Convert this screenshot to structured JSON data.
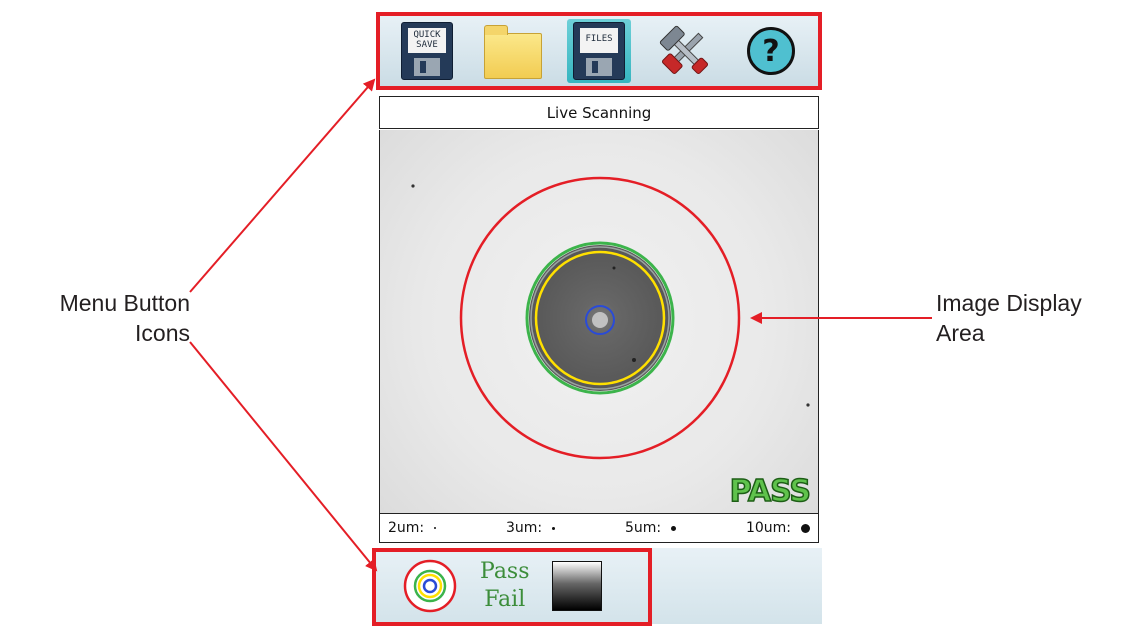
{
  "toolbar": {
    "buttons": [
      {
        "name": "quick-save",
        "icon": "floppy-disk-icon",
        "label": "QUICK SAVE"
      },
      {
        "name": "folder",
        "icon": "folder-icon"
      },
      {
        "name": "files",
        "icon": "floppy-disk-icon",
        "label": "FILES",
        "active": true
      },
      {
        "name": "settings",
        "icon": "wrench-hammer-icon"
      },
      {
        "name": "help",
        "icon": "help-icon",
        "glyph": "?"
      }
    ]
  },
  "status_text": "Live Scanning",
  "image": {
    "verdict": "PASS",
    "verdict_color": "#5fc24c",
    "zones": [
      {
        "name": "contact-zone",
        "color": "#e41e26"
      },
      {
        "name": "adhesive-zone",
        "color": "#3cb44b"
      },
      {
        "name": "cladding-zone",
        "color": "#ffe000"
      },
      {
        "name": "core-zone",
        "color": "#2a4bd7"
      }
    ]
  },
  "scale": [
    {
      "label": "2um:"
    },
    {
      "label": "3um:"
    },
    {
      "label": "5um:"
    },
    {
      "label": "10um:"
    }
  ],
  "bottom_bar": {
    "pass_label": "Pass",
    "fail_label": "Fail",
    "pass_color": "#3c8d3a"
  },
  "annotations": {
    "menu_label_line1": "Menu Button",
    "menu_label_line2": "Icons",
    "image_label_line1": "Image Display",
    "image_label_line2": "Area",
    "highlight_color": "#e41e26"
  }
}
